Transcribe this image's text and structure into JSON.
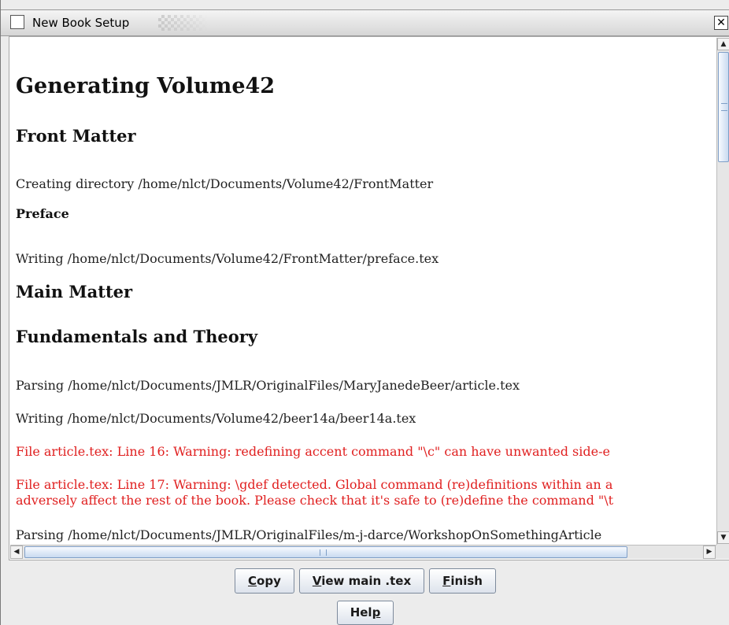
{
  "window": {
    "title": "New Book Setup",
    "close_glyph": "✕"
  },
  "document": {
    "heading": "Generating Volume42",
    "front_matter_heading": "Front Matter",
    "line_create_dir": "Creating directory /home/nlct/Documents/Volume42/FrontMatter",
    "preface_heading": "Preface",
    "line_write_preface": "Writing /home/nlct/Documents/Volume42/FrontMatter/preface.tex",
    "main_matter_heading": "Main Matter",
    "fundamentals_heading": "Fundamentals and Theory",
    "line_parse_beer": "Parsing /home/nlct/Documents/JMLR/OriginalFiles/MaryJanedeBeer/article.tex",
    "line_write_beer": "Writing /home/nlct/Documents/Volume42/beer14a/beer14a.tex",
    "warning_line16": "File article.tex: Line 16: Warning: redefining accent command \"\\c\" can have unwanted side-e",
    "warning_line17_a": "File article.tex: Line 17: Warning: \\gdef detected. Global command (re)definitions within an a",
    "warning_line17_b": "adversely affect the rest of the book. Please check that it's safe to (re)define the command \"\\t",
    "line_parse_darce": "Parsing /home/nlct/Documents/JMLR/OriginalFiles/m-j-darce/WorkshopOnSomethingArticle"
  },
  "colors": {
    "warning": "#e02020",
    "scroll_thumb": "#c9daf0"
  },
  "buttons": {
    "copy": {
      "pre": "",
      "mnemonic": "C",
      "post": "opy"
    },
    "view_main": {
      "pre": "",
      "mnemonic": "V",
      "post": "iew main .tex"
    },
    "finish": {
      "pre": "",
      "mnemonic": "F",
      "post": "inish"
    },
    "help": {
      "pre": "Hel",
      "mnemonic": "p",
      "post": ""
    }
  }
}
